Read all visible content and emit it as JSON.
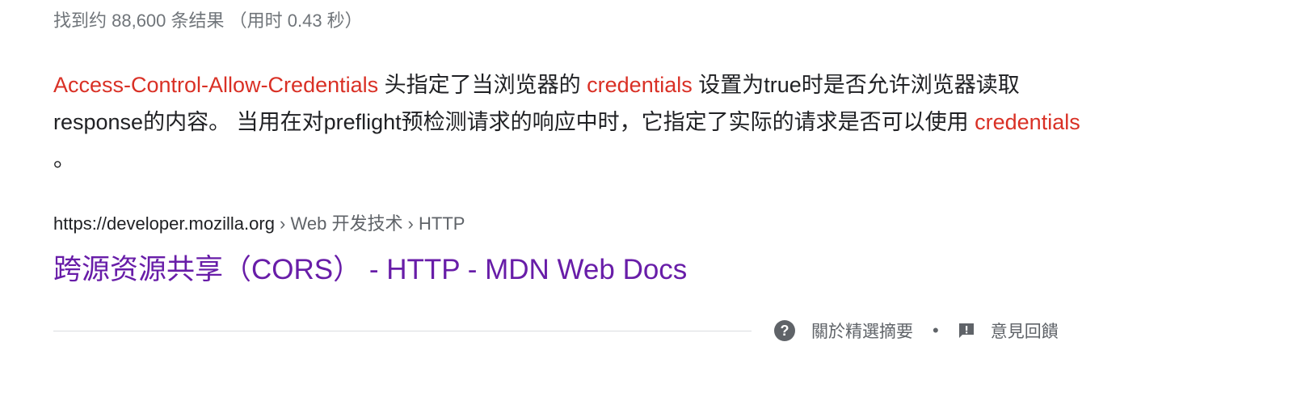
{
  "result_stats": "找到约 88,600 条结果 （用时 0.43 秒）",
  "snippet": {
    "hl1": "Access-Control-Allow-Credentials",
    "t1": " 头指定了当浏览器的 ",
    "hl2": "credentials",
    "t2": " 设置为true时是否允许浏览器读取response的内容。 当用在对preflight预检测请求的响应中时，它指定了实际的请求是否可以使用 ",
    "hl3": "credentials",
    "t3": " 。"
  },
  "result": {
    "url": "https://developer.mozilla.org",
    "breadcrumb": " › Web 开发技术 › HTTP",
    "title": "跨源资源共享（CORS） - HTTP - MDN Web Docs"
  },
  "footer": {
    "about_label": "關於精選摘要",
    "separator": "•",
    "feedback_label": "意見回饋"
  },
  "icons": {
    "help": "help-circle-icon",
    "feedback": "feedback-icon"
  },
  "colors": {
    "highlight": "#d93025",
    "visited_link": "#681da8",
    "secondary_text": "#70757a",
    "body_text": "#202124"
  }
}
